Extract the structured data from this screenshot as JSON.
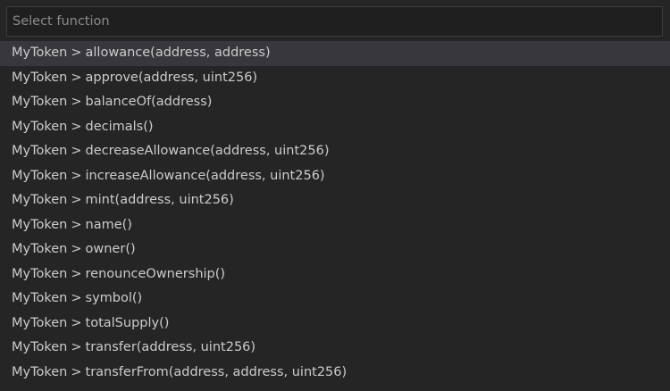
{
  "search": {
    "placeholder": "Select function",
    "value": ""
  },
  "functions": {
    "selected_index": 0,
    "items": [
      {
        "contract": "MyToken",
        "separator": ">",
        "signature": "allowance(address, address)"
      },
      {
        "contract": "MyToken",
        "separator": ">",
        "signature": "approve(address, uint256)"
      },
      {
        "contract": "MyToken",
        "separator": ">",
        "signature": "balanceOf(address)"
      },
      {
        "contract": "MyToken",
        "separator": ">",
        "signature": "decimals()"
      },
      {
        "contract": "MyToken",
        "separator": ">",
        "signature": "decreaseAllowance(address, uint256)"
      },
      {
        "contract": "MyToken",
        "separator": ">",
        "signature": "increaseAllowance(address, uint256)"
      },
      {
        "contract": "MyToken",
        "separator": ">",
        "signature": "mint(address, uint256)"
      },
      {
        "contract": "MyToken",
        "separator": ">",
        "signature": "name()"
      },
      {
        "contract": "MyToken",
        "separator": ">",
        "signature": "owner()"
      },
      {
        "contract": "MyToken",
        "separator": ">",
        "signature": "renounceOwnership()"
      },
      {
        "contract": "MyToken",
        "separator": ">",
        "signature": "symbol()"
      },
      {
        "contract": "MyToken",
        "separator": ">",
        "signature": "totalSupply()"
      },
      {
        "contract": "MyToken",
        "separator": ">",
        "signature": "transfer(address, uint256)"
      },
      {
        "contract": "MyToken",
        "separator": ">",
        "signature": "transferFrom(address, address, uint256)"
      }
    ]
  },
  "colors": {
    "background": "#252526",
    "selected_background": "#37373d",
    "text": "#cccccc",
    "placeholder": "#8b8b8b",
    "input_border": "#3c3c3c"
  }
}
